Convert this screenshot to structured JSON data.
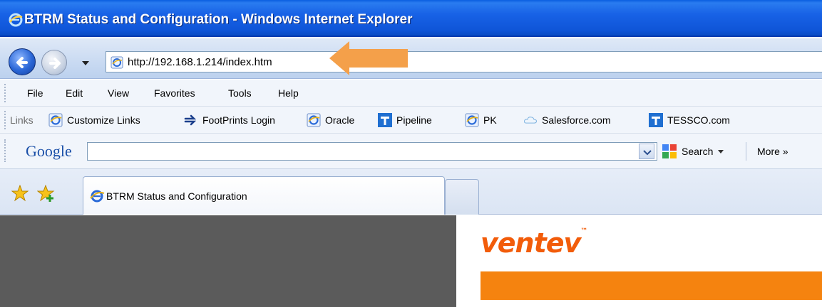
{
  "window": {
    "title": "BTRM Status and Configuration - Windows Internet Explorer"
  },
  "address_bar": {
    "url": "http://192.168.1.214/index.htm"
  },
  "menu": {
    "items": [
      "File",
      "Edit",
      "View",
      "Favorites",
      "Tools",
      "Help"
    ]
  },
  "links_bar": {
    "label": "Links",
    "items": [
      {
        "label": "Customize Links",
        "icon": "ie-page-icon"
      },
      {
        "label": "FootPrints Login",
        "icon": "footprints-icon"
      },
      {
        "label": "Oracle",
        "icon": "ie-page-icon"
      },
      {
        "label": "Pipeline",
        "icon": "tessco-t-icon"
      },
      {
        "label": "PK",
        "icon": "ie-page-icon"
      },
      {
        "label": "Salesforce.com",
        "icon": "cloud-icon"
      },
      {
        "label": "TESSCO.com",
        "icon": "tessco-t-icon"
      }
    ]
  },
  "google_toolbar": {
    "logo": "Google",
    "search_value": "",
    "search_label": "Search",
    "more_label": "More »"
  },
  "tabs": {
    "items": [
      {
        "label": "BTRM Status and Configuration",
        "active": true
      }
    ]
  },
  "page": {
    "logo_text": "ventev"
  },
  "colors": {
    "titlebar": "#0f55d8",
    "annotation_arrow": "#f4a04a",
    "ventev_orange": "#f25c0a",
    "band_orange": "#f5830f",
    "left_panel": "#5b5b5b"
  }
}
